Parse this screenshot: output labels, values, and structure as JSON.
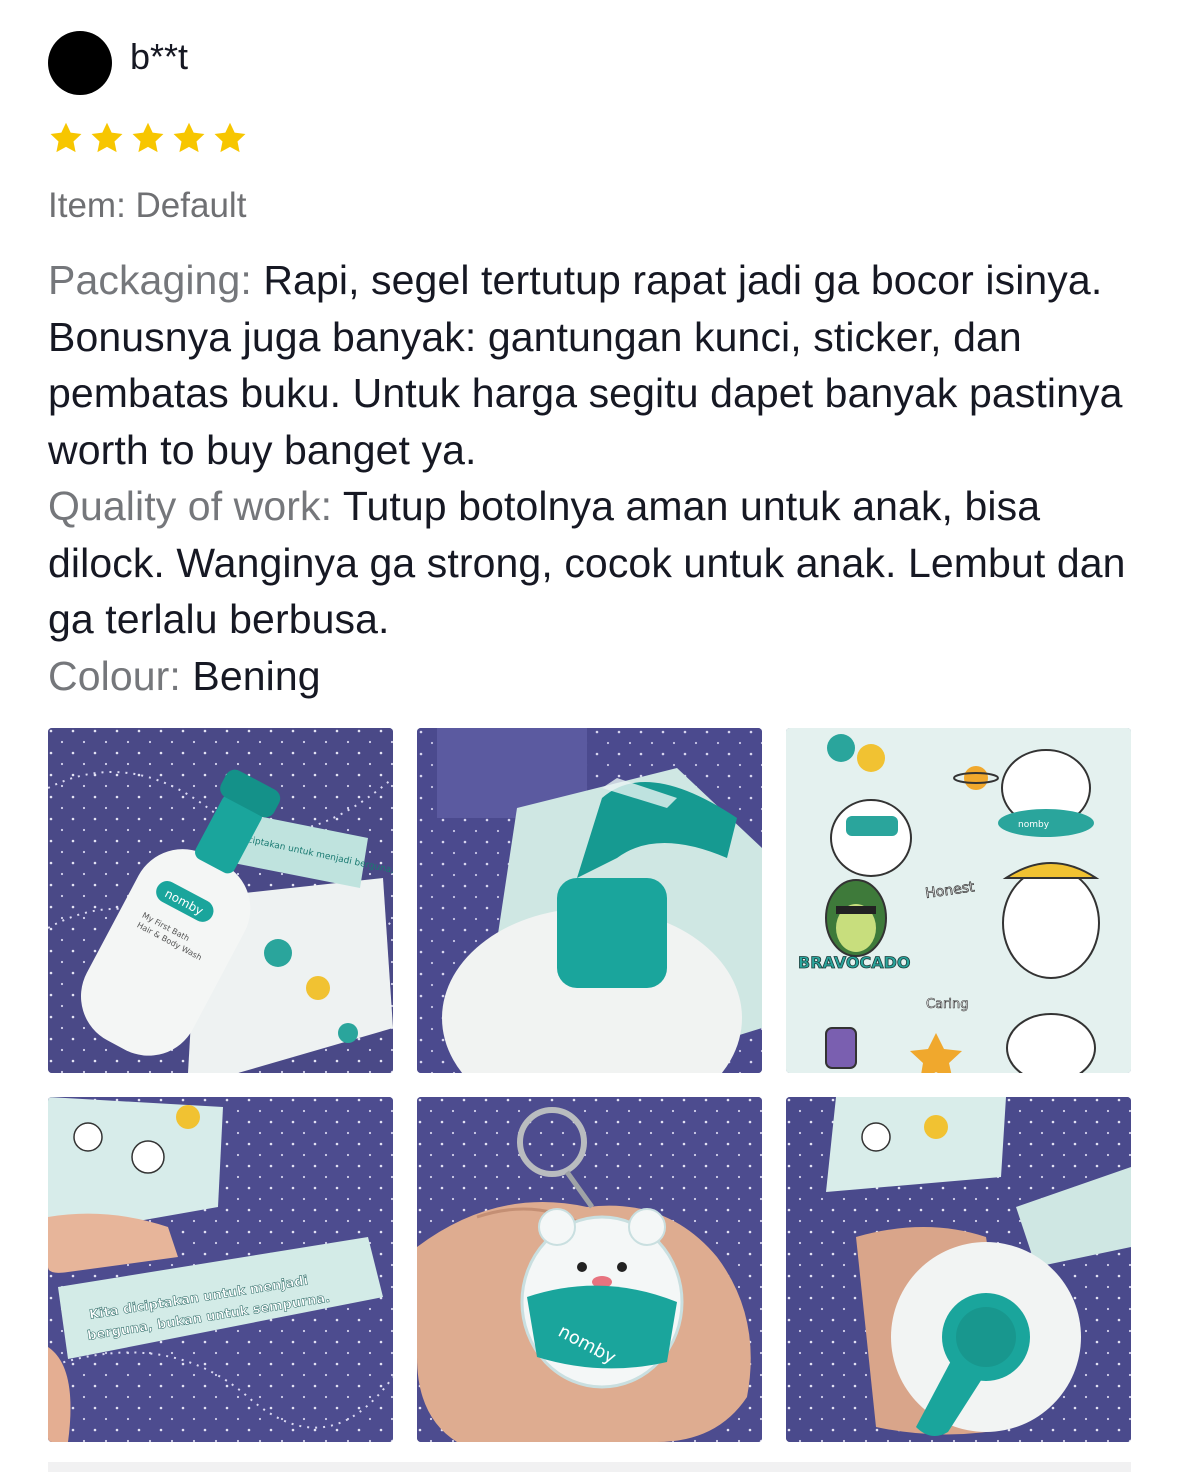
{
  "review": {
    "username": "b**t",
    "rating": 5,
    "star_color": "#f7c600",
    "item": "Item: Default",
    "paragraphs": [
      {
        "label": "Packaging:",
        "text": " Rapi, segel tertutup rapat jadi ga bocor isinya. Bonusnya juga banyak: gantungan kunci, sticker, dan pembatas buku. Untuk harga segitu dapet banyak pastinya worth to buy banget ya."
      },
      {
        "label": "Quality of work:",
        "text": " Tutup botolnya aman untuk anak, bisa dilock. Wanginya ga strong, cocok untuk anak. Lembut dan ga terlalu berbusa."
      },
      {
        "label": "Colour:",
        "text": " Bening"
      }
    ]
  },
  "photos": {
    "p1": {
      "brand": "nomby",
      "product_line1": "My First Bath",
      "product_line2": "Hair & Body Wash",
      "card_text": "Diciptakan untuk menjadi berguna, bukan untuk sempurna."
    },
    "p3": {
      "sticker_honest": "Honest",
      "sticker_caring": "Caring",
      "sticker_bravocado": "BRAVOCADO",
      "brand": "nomby"
    },
    "p4": {
      "bookmark_line1": "Kita diciptakan untuk menjadi",
      "bookmark_line2": "berguna, bukan untuk sempurna."
    },
    "p5": {
      "brand": "nomby"
    }
  },
  "colors": {
    "teal": "#1aa59c",
    "fabric": "#4b4a8e",
    "label_gray": "#75777b"
  }
}
